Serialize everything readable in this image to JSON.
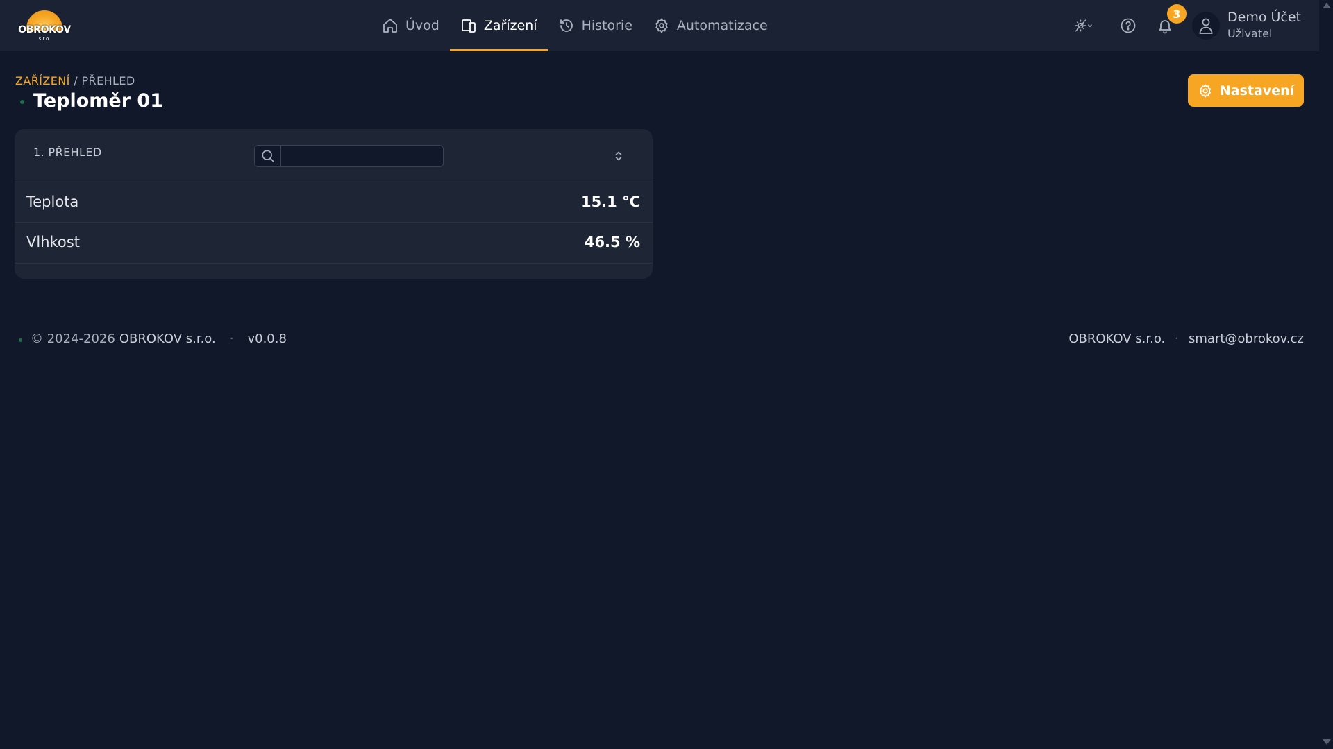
{
  "brand": {
    "name": "OBROKOV",
    "suffix": "s.r.o."
  },
  "nav": [
    {
      "label": "Úvod",
      "icon": "home-icon"
    },
    {
      "label": "Zařízení",
      "icon": "devices-icon",
      "active": true
    },
    {
      "label": "Historie",
      "icon": "history-icon"
    },
    {
      "label": "Automatizace",
      "icon": "automation-gear-icon"
    }
  ],
  "header": {
    "notification_count": "3",
    "user_name": "Demo Účet",
    "user_role": "Uživatel"
  },
  "breadcrumb": {
    "parent": "ZAŘÍZENÍ",
    "separator": "/",
    "current": "PŘEHLED"
  },
  "page_title": "Teploměr 01",
  "settings_button": "Nastavení",
  "card": {
    "section_label": "1. PŘEHLED",
    "search": {
      "value": "",
      "placeholder": ""
    },
    "rows": [
      {
        "label": "Teplota",
        "value": "15.1 °C"
      },
      {
        "label": "Vlhkost",
        "value": "46.5 %"
      }
    ]
  },
  "footer": {
    "copyright": "© 2024-2026",
    "company": "OBROKOV s.r.o.",
    "separator": "·",
    "version": "v0.0.8",
    "right_company": "OBROKOV s.r.o.",
    "email": "smart@obrokov.cz"
  },
  "colors": {
    "accent": "#f6a623",
    "background": "#111829",
    "header": "#1a2233",
    "card": "#1e2636"
  }
}
